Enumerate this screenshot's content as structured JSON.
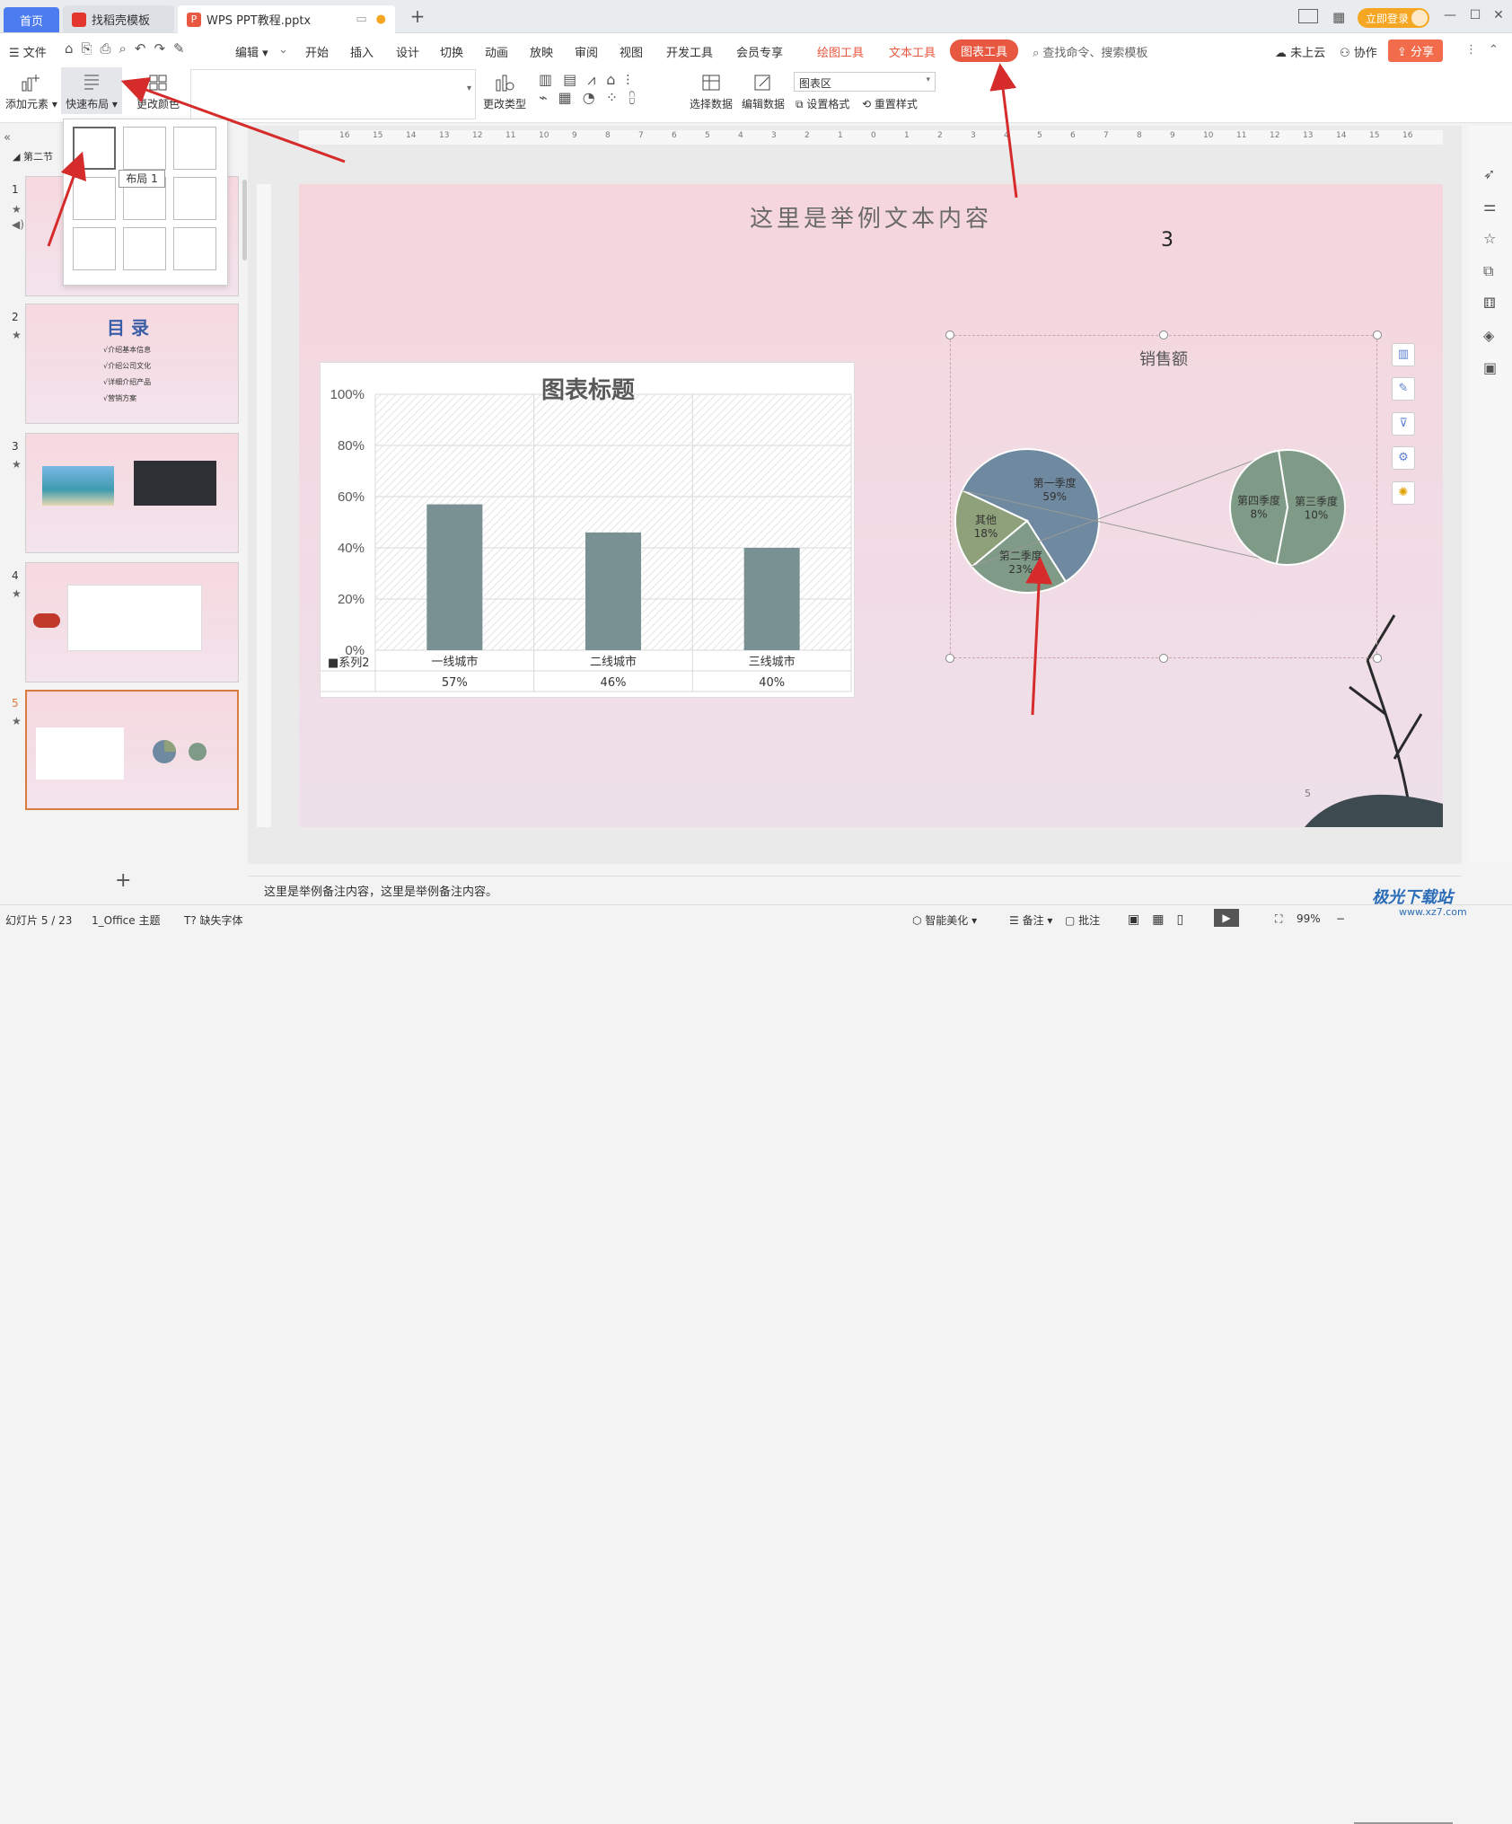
{
  "tabs": {
    "home": "首页",
    "daoke": "找稻壳模板",
    "ppt": "WPS PPT教程.pptx"
  },
  "login": "立即登录",
  "menu": {
    "file": "文件",
    "edit": "编辑",
    "items": [
      "开始",
      "插入",
      "设计",
      "切换",
      "动画",
      "放映",
      "审阅",
      "视图",
      "开发工具",
      "会员专享"
    ],
    "draw": "绘图工具",
    "text": "文本工具",
    "chart": "图表工具",
    "search": "查找命令、搜索模板",
    "cloud": "未上云",
    "collab": "协作",
    "share": "分享"
  },
  "ribbon": {
    "add_element": "添加元素",
    "quick_layout": "快速布局",
    "change_color": "更改颜色",
    "change_type": "更改类型",
    "select_data": "选择数据",
    "edit_data": "编辑数据",
    "chart_area": "图表区",
    "set_format": "设置格式",
    "reset_style": "重置样式"
  },
  "layout_tooltip": "布局 1",
  "panel": {
    "section": "第二节"
  },
  "slides": [
    {
      "num": "1"
    },
    {
      "num": "2",
      "title": "目 录",
      "items": [
        "√介绍基本信息",
        "√介绍公司文化",
        "√详细介绍产品",
        "√营销方案"
      ]
    },
    {
      "num": "3"
    },
    {
      "num": "4"
    },
    {
      "num": "5"
    }
  ],
  "slide": {
    "title": "这里是举例文本内容",
    "number": "3",
    "page": "5"
  },
  "bar_chart": {
    "title": "图表标题",
    "series_label": "■系列2"
  },
  "pie_chart": {
    "title": "销售额"
  },
  "chart_data": [
    {
      "type": "bar",
      "title": "图表标题",
      "categories": [
        "一线城市",
        "二线城市",
        "三线城市"
      ],
      "series": [
        {
          "name": "系列2",
          "values": [
            0.57,
            0.46,
            0.4
          ]
        }
      ],
      "value_labels": [
        "57%",
        "46%",
        "40%"
      ],
      "ylim": [
        0,
        1
      ],
      "yticks": [
        "0%",
        "20%",
        "40%",
        "60%",
        "80%",
        "100%"
      ]
    },
    {
      "type": "pie",
      "title": "销售额",
      "slices": [
        {
          "label": "第一季度",
          "value": 59,
          "text": "59%"
        },
        {
          "label": "第二季度",
          "value": 23,
          "text": "23%"
        },
        {
          "label": "其他",
          "value": 18,
          "text": "18%"
        }
      ],
      "secondary": [
        {
          "label": "第三季度",
          "value": 10,
          "text": "10%"
        },
        {
          "label": "第四季度",
          "value": 8,
          "text": "8%"
        }
      ]
    }
  ],
  "notes": "这里是举例备注内容，这里是举例备注内容。",
  "status": {
    "slide": "幻灯片 5 / 23",
    "theme": "1_Office 主题",
    "font": "缺失字体",
    "beautify": "智能美化",
    "notes": "备注",
    "comment": "批注",
    "zoom": "99%"
  },
  "watermark": "极光下载站",
  "watermark_url": "www.xz7.com",
  "colors": {
    "accent": "#4d7cf0",
    "chart_tool": "#e8573f",
    "bar": "#7a9193",
    "pie_a": "#6f8aa0",
    "pie_b": "#7f9a86",
    "pie_c": "#8fa17a"
  }
}
